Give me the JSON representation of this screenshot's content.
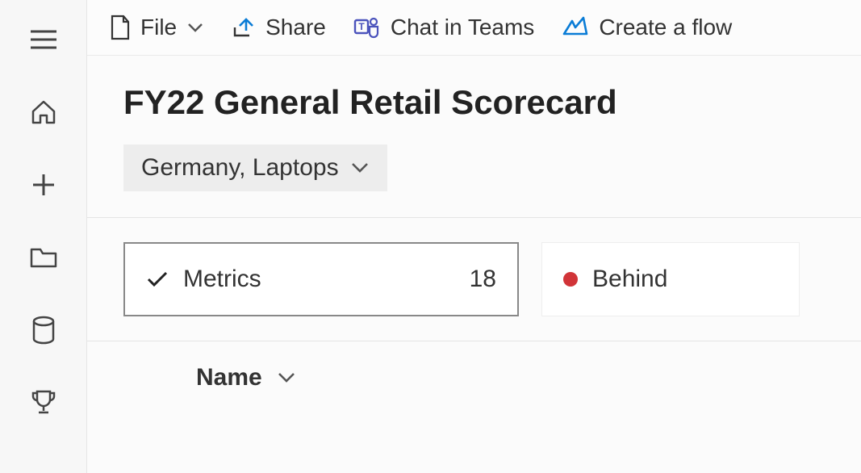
{
  "toolbar": {
    "file": "File",
    "share": "Share",
    "chat": "Chat in Teams",
    "flow": "Create a flow"
  },
  "page": {
    "title": "FY22 General Retail Scorecard",
    "filter": "Germany, Laptops"
  },
  "cards": {
    "metrics_label": "Metrics",
    "metrics_count": "18",
    "behind_label": "Behind"
  },
  "table": {
    "col_name": "Name"
  }
}
